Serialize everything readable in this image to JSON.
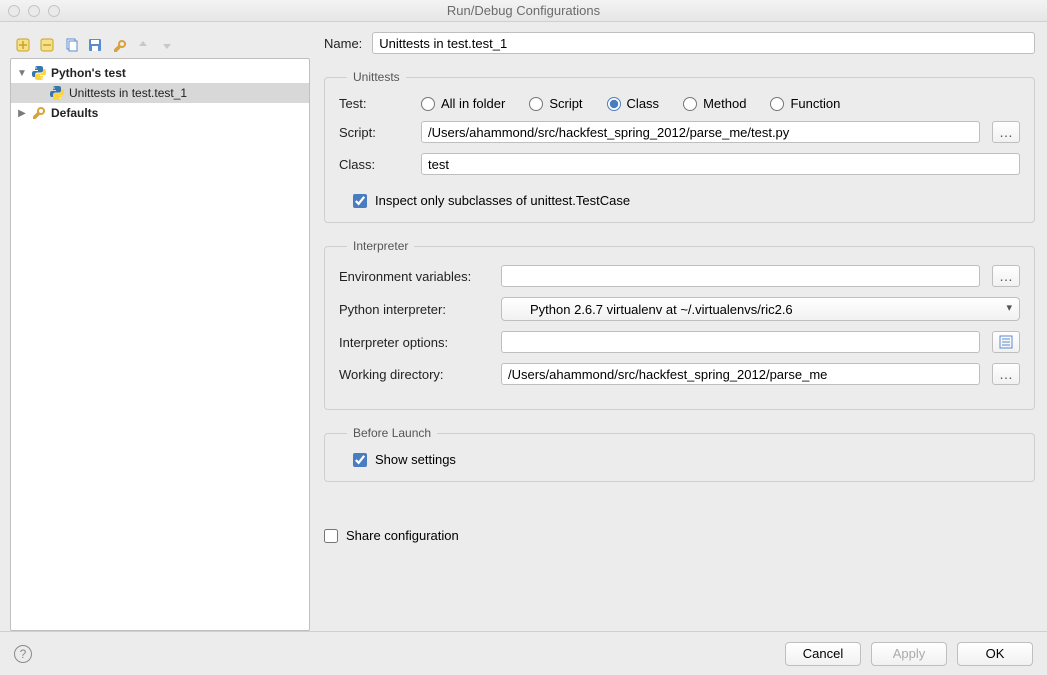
{
  "window": {
    "title": "Run/Debug Configurations"
  },
  "toolbar_icons": {
    "add": "add-icon",
    "remove": "remove-icon",
    "copy": "copy-icon",
    "save": "save-icon",
    "wrench": "wrench-icon",
    "up": "up-arrow-icon",
    "down": "down-arrow-icon"
  },
  "tree": {
    "items": [
      {
        "label": "Python's test",
        "bold": true,
        "depth": 0,
        "expanded": true,
        "icon": "python"
      },
      {
        "label": "Unittests in test.test_1",
        "bold": false,
        "depth": 1,
        "selected": true,
        "icon": "python"
      },
      {
        "label": "Defaults",
        "bold": true,
        "depth": 0,
        "expanded": false,
        "icon": "wrench"
      }
    ]
  },
  "name": {
    "label": "Name:",
    "value": "Unittests in test.test_1"
  },
  "unittests": {
    "legend": "Unittests",
    "test_label": "Test:",
    "radios": {
      "options": [
        "All in folder",
        "Script",
        "Class",
        "Method",
        "Function"
      ],
      "selected": "Class"
    },
    "script_label": "Script:",
    "script_value": "/Users/ahammond/src/hackfest_spring_2012/parse_me/test.py",
    "class_label": "Class:",
    "class_value": "test",
    "inspect_label": "Inspect only subclasses of unittest.TestCase",
    "inspect_checked": true
  },
  "interpreter": {
    "legend": "Interpreter",
    "env_vars_label": "Environment variables:",
    "env_vars_value": "",
    "python_interp_label": "Python interpreter:",
    "python_interp_value": "Python 2.6.7 virtualenv at ~/.virtualenvs/ric2.6",
    "interp_opts_label": "Interpreter options:",
    "interp_opts_value": "",
    "workdir_label": "Working directory:",
    "workdir_value": "/Users/ahammond/src/hackfest_spring_2012/parse_me"
  },
  "before_launch": {
    "legend": "Before Launch",
    "show_settings_label": "Show settings",
    "show_settings_checked": true
  },
  "share": {
    "label": "Share configuration",
    "checked": false
  },
  "footer": {
    "cancel": "Cancel",
    "apply": "Apply",
    "ok": "OK"
  }
}
